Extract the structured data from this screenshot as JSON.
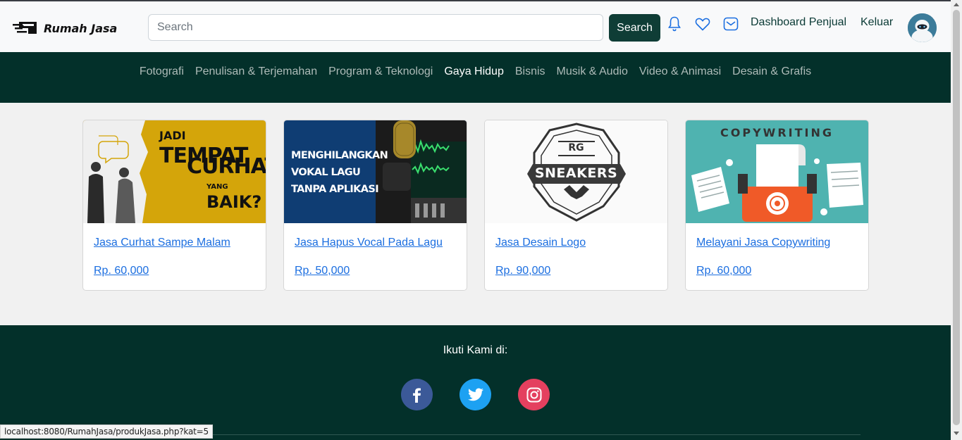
{
  "header": {
    "brand": "Rumah Jasa",
    "search_placeholder": "Search",
    "search_button": "Search",
    "dashboard_link": "Dashboard Penjual",
    "logout_link": "Keluar",
    "icons": [
      "bell-icon",
      "heart-icon",
      "envelope-icon"
    ]
  },
  "categories": [
    {
      "label": "Fotografi",
      "active": false
    },
    {
      "label": "Penulisan & Terjemahan",
      "active": false
    },
    {
      "label": "Program & Teknologi",
      "active": false
    },
    {
      "label": "Gaya Hidup",
      "active": true
    },
    {
      "label": "Bisnis",
      "active": false
    },
    {
      "label": "Musik & Audio",
      "active": false
    },
    {
      "label": "Video & Animasi",
      "active": false
    },
    {
      "label": "Desain & Grafis",
      "active": false
    }
  ],
  "products": [
    {
      "title": "Jasa Curhat Sampe Malam",
      "price": "Rp. 60,000",
      "image_text": {
        "line1a": "JADI",
        "line1b": "TEMPAT",
        "line2": "CURHAT",
        "line3a": "YANG",
        "line3b": "BAIK?"
      }
    },
    {
      "title": "Jasa Hapus Vocal Pada Lagu",
      "price": "Rp. 50,000",
      "image_text": {
        "line1": "MENGHILANGKAN",
        "line2": "VOKAL LAGU",
        "line3": "TANPA APLIKASI"
      }
    },
    {
      "title": "Jasa Desain Logo",
      "price": "Rp. 90,000",
      "image_text": {
        "line1": "RG",
        "line2": "SNEAKERS"
      }
    },
    {
      "title": "Melayani Jasa Copywriting",
      "price": "Rp. 60,000",
      "image_text": {
        "line1": "COPYWRITING"
      }
    }
  ],
  "footer": {
    "follow_label": "Ikuti Kami di:",
    "socials": [
      {
        "name": "facebook",
        "color": "#3b5998"
      },
      {
        "name": "twitter",
        "color": "#1da1f2"
      },
      {
        "name": "instagram",
        "color": "#e4405f"
      }
    ]
  },
  "status_url": "localhost:8080/RumahJasa/produkJasa.php?kat=5",
  "colors": {
    "primary": "#0f3d36",
    "nav_bg": "#03302a",
    "link": "#1b6ee0"
  }
}
